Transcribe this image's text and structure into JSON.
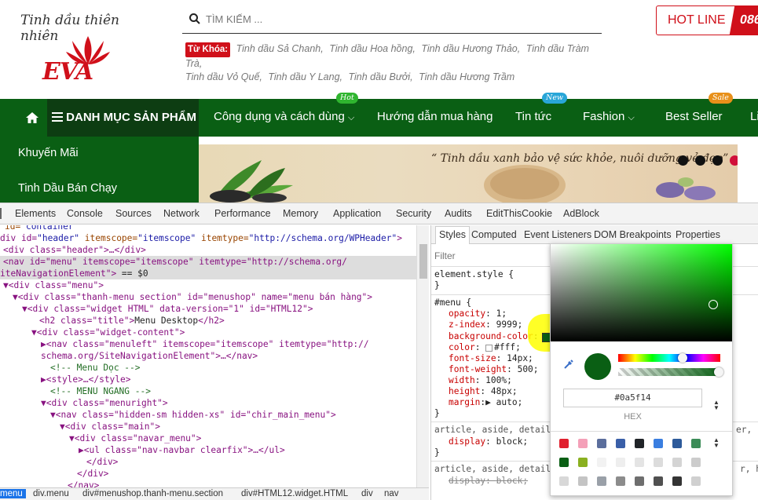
{
  "site": {
    "logo_text": "Tinh dầu thiên nhiên",
    "logo_brand": "EVA",
    "search_placeholder": "TÌM KIẾM ...",
    "keywords_label": "Từ Khóa:",
    "keywords": [
      "Tinh dầu Sả Chanh,",
      "Tinh dầu Hoa hồng,",
      "Tinh dầu Hương Thảo,",
      "Tinh dầu Tràm Trà,",
      "Tinh dầu Vỏ Quế,",
      "Tinh dầu Y Lang,",
      "Tinh dầu Bưởi,",
      "Tinh dầu Hương Trầm"
    ],
    "hotline_label": "HOT LINE",
    "hotline_number": "086",
    "nav": {
      "category": "DANH MỤC SẢN PHẨM",
      "items": [
        "Công dụng và cách dùng",
        "Hướng dẫn mua hàng",
        "Tin tức",
        "Fashion",
        "Best Seller",
        "Li"
      ],
      "badges": [
        "Hot",
        "New",
        "Sale"
      ]
    },
    "side_menu": [
      "Khuyến Mãi",
      "Tinh Dầu Bán Chạy"
    ],
    "banner_quote": "“ Tinh dầu xanh bảo vệ sức khỏe, nuôi dưỡng vẻ đẹp”"
  },
  "devtools": {
    "tabs": [
      "Elements",
      "Console",
      "Sources",
      "Network",
      "Performance",
      "Memory",
      "Application",
      "Security",
      "Audits",
      "EditThisCookie",
      "AdBlock"
    ],
    "dom": {
      "l0_a": " id=\"",
      "l0_b": "container",
      "l0_c": "\"",
      "l1_tag": "div id=",
      "l1_v1": "\"header\"",
      "l1_n2": " itemscope=",
      "l1_v2": "\"itemscope\"",
      "l1_n3": " itemtype=",
      "l1_v3": "\"http://schema.org/WPHeader\"",
      "l1_end": ">",
      "l2": "<div class=\"header\">…</div>",
      "l3": "<nav id=\"menu\" itemscope=\"itemscope\" itemtype=\"http://schema.org/",
      "l4": "iteNavigationElement\">",
      "l4_eq": " == $0",
      "l5": "▼<div class=\"menu\">",
      "l6": "▼<div class=\"thanh-menu section\" id=\"menushop\" name=\"menu bán hàng\">",
      "l7": "▼<div class=\"widget HTML\" data-version=\"1\" id=\"HTML12\">",
      "l8_open": "<h2 class=\"title\">",
      "l8_text": "Menu Desktop",
      "l8_close": "</h2>",
      "l9": "▼<div class=\"widget-content\">",
      "l10": "▶<nav class=\"menuleft\" itemscope=\"itemscope\" itemtype=\"http://",
      "l11": "schema.org/SiteNavigationElement\">…</nav>",
      "l12": "<!-- Menu Dọc -->",
      "l13": "▶<style>…</style>",
      "l14": "<!-- MENU NGANG -->",
      "l15": "▼<div class=\"menuright\">",
      "l16": "▼<nav class=\"hidden-sm hidden-xs\" id=\"chir_main_menu\">",
      "l17": "▼<div class=\"main\">",
      "l18": "▼<div class=\"navar_menu\">",
      "l19": "▶<ul class=\"nav-navbar clearfix\">…</ul>",
      "l20": "</div>",
      "l21": "</div>",
      "l22": "</nav>"
    },
    "breadcrumbs": [
      "menu",
      "div.menu",
      "div#menushop.thanh-menu.section",
      "div#HTML12.widget.HTML",
      "div",
      "nav"
    ],
    "styles_tabs": [
      "Styles",
      "Computed",
      "Event Listeners",
      "DOM Breakpoints",
      "Properties"
    ],
    "filter_placeholder": "Filter",
    "styles": {
      "element_style": "element.style {",
      "close": "}",
      "menu_selector": "#menu {",
      "props": [
        {
          "name": "opacity",
          "value": "1;"
        },
        {
          "name": "z-index",
          "value": "9999;"
        },
        {
          "name": "background-color",
          "value": ""
        },
        {
          "name": "color",
          "value": "#fff;"
        },
        {
          "name": "font-size",
          "value": "14px;"
        },
        {
          "name": "font-weight",
          "value": "500;"
        },
        {
          "name": "width",
          "value": "100%;"
        },
        {
          "name": "height",
          "value": "48px;"
        },
        {
          "name": "margin",
          "value": "auto;"
        }
      ],
      "article_selector_1": "article, aside, details",
      "article_tail_1": "er, hg",
      "display_prop": "display",
      "display_value": "block;",
      "article_selector_2": "article, aside, details",
      "article_tail_2": "r, hg"
    },
    "picker": {
      "hex_value": "#0a5f14",
      "hex_label": "HEX",
      "palette": [
        "#e0202e",
        "#f4a0b8",
        "#5b6e9c",
        "#3a5fa8",
        "#202428",
        "#3a7ee0",
        "#2d5a9a",
        "#3c8c58",
        "#0a5f14",
        "#8ab020",
        "#f2f2f2",
        "#eeeeee",
        "#e4e4e4",
        "#dcdcdc",
        "#d4d4d4",
        "#cccccc",
        "#d8d8d8",
        "#c4c4c4",
        "#9aa0a8",
        "#8c8c8c",
        "#6e6e6e",
        "#505050",
        "#343434",
        "#d0d0d0"
      ]
    }
  },
  "colors": {
    "nav_green": "#0a5f14",
    "brand_red": "#d0101a"
  }
}
